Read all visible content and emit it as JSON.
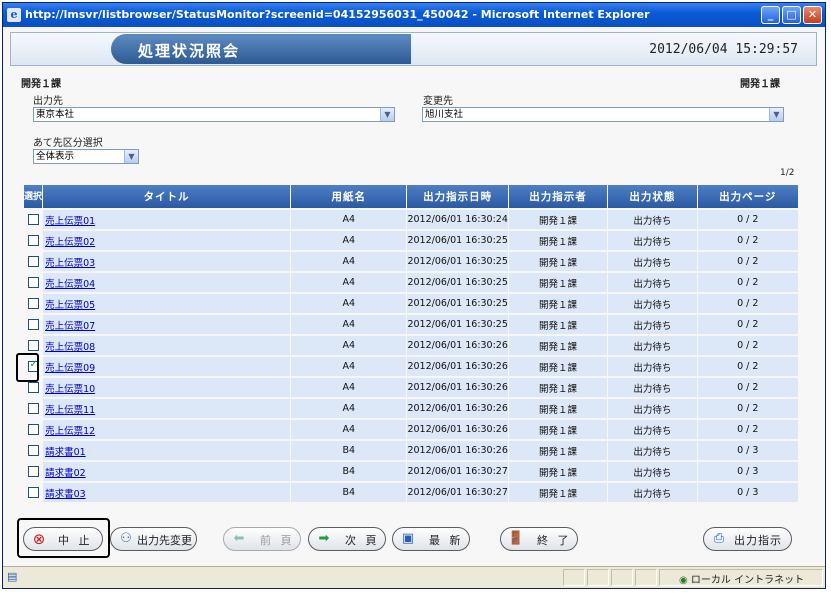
{
  "window": {
    "title": "http://lmsvr/listbrowser/StatusMonitor?screenid=04152956031_450042 - Microsoft Internet Explorer",
    "icon": "ie-icon"
  },
  "header": {
    "title": "処理状況照会",
    "datetime": "2012/06/04 15:29:57"
  },
  "dept_left": "開発１課",
  "dept_right": "開発１課",
  "output_to": {
    "label": "出力先",
    "value": "東京本社"
  },
  "change_to": {
    "label": "変更先",
    "value": "旭川支社"
  },
  "dest_type": {
    "label": "あて先区分選択",
    "value": "全体表示"
  },
  "page_indicator": "1/2",
  "table": {
    "headers": [
      "選択",
      "タイトル",
      "用紙名",
      "出力指示日時",
      "出力指示者",
      "出力状態",
      "出力ページ"
    ],
    "rows": [
      {
        "checked": false,
        "title": "売上伝票01",
        "paper": "A4",
        "datetime": "2012/06/01 16:30:24",
        "user": "開発１課",
        "status": "出力待ち",
        "pages": "0 / 2"
      },
      {
        "checked": false,
        "title": "売上伝票02",
        "paper": "A4",
        "datetime": "2012/06/01 16:30:25",
        "user": "開発１課",
        "status": "出力待ち",
        "pages": "0 / 2"
      },
      {
        "checked": false,
        "title": "売上伝票03",
        "paper": "A4",
        "datetime": "2012/06/01 16:30:25",
        "user": "開発１課",
        "status": "出力待ち",
        "pages": "0 / 2"
      },
      {
        "checked": false,
        "title": "売上伝票04",
        "paper": "A4",
        "datetime": "2012/06/01 16:30:25",
        "user": "開発１課",
        "status": "出力待ち",
        "pages": "0 / 2"
      },
      {
        "checked": false,
        "title": "売上伝票05",
        "paper": "A4",
        "datetime": "2012/06/01 16:30:25",
        "user": "開発１課",
        "status": "出力待ち",
        "pages": "0 / 2"
      },
      {
        "checked": false,
        "title": "売上伝票07",
        "paper": "A4",
        "datetime": "2012/06/01 16:30:25",
        "user": "開発１課",
        "status": "出力待ち",
        "pages": "0 / 2"
      },
      {
        "checked": false,
        "title": "売上伝票08",
        "paper": "A4",
        "datetime": "2012/06/01 16:30:26",
        "user": "開発１課",
        "status": "出力待ち",
        "pages": "0 / 2"
      },
      {
        "checked": true,
        "title": "売上伝票09",
        "paper": "A4",
        "datetime": "2012/06/01 16:30:26",
        "user": "開発１課",
        "status": "出力待ち",
        "pages": "0 / 2"
      },
      {
        "checked": false,
        "title": "売上伝票10",
        "paper": "A4",
        "datetime": "2012/06/01 16:30:26",
        "user": "開発１課",
        "status": "出力待ち",
        "pages": "0 / 2"
      },
      {
        "checked": false,
        "title": "売上伝票11",
        "paper": "A4",
        "datetime": "2012/06/01 16:30:26",
        "user": "開発１課",
        "status": "出力待ち",
        "pages": "0 / 2"
      },
      {
        "checked": false,
        "title": "売上伝票12",
        "paper": "A4",
        "datetime": "2012/06/01 16:30:26",
        "user": "開発１課",
        "status": "出力待ち",
        "pages": "0 / 2"
      },
      {
        "checked": false,
        "title": "請求書01",
        "paper": "B4",
        "datetime": "2012/06/01 16:30:26",
        "user": "開発１課",
        "status": "出力待ち",
        "pages": "0 / 3"
      },
      {
        "checked": false,
        "title": "請求書02",
        "paper": "B4",
        "datetime": "2012/06/01 16:30:27",
        "user": "開発１課",
        "status": "出力待ち",
        "pages": "0 / 3"
      },
      {
        "checked": false,
        "title": "請求書03",
        "paper": "B4",
        "datetime": "2012/06/01 16:30:27",
        "user": "開発１課",
        "status": "出力待ち",
        "pages": "0 / 3"
      }
    ]
  },
  "buttons": {
    "stop": "中 止",
    "change_dest": "出力先変更",
    "prev": "前 頁",
    "next": "次 頁",
    "refresh": "最 新",
    "exit": "終 了",
    "print": "出力指示"
  },
  "statusbar": {
    "zone": "ローカル イントラネット"
  }
}
